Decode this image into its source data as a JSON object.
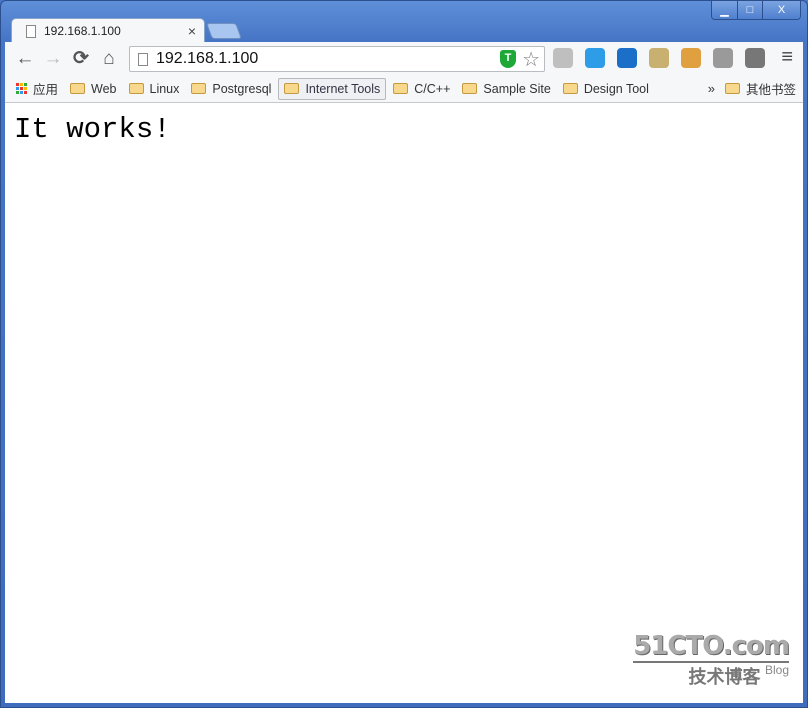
{
  "tab": {
    "title": "192.168.1.100",
    "close": "×"
  },
  "window": {
    "minimize": "▁",
    "maximize": "□",
    "close": "X"
  },
  "toolbar": {
    "back": "←",
    "forward": "→",
    "reload": "⟳",
    "home": "⌂",
    "url": "192.168.1.100",
    "shield": "T",
    "star": "☆",
    "menu": "≡",
    "extensions": [
      {
        "name": "sync-icon",
        "color": "#bfbfbf"
      },
      {
        "name": "pen-icon",
        "color": "#2e9de8"
      },
      {
        "name": "search-ext-icon",
        "color": "#1c6fc9"
      },
      {
        "name": "image-download-icon",
        "color": "#c8b070"
      },
      {
        "name": "color-picker-icon",
        "color": "#e0a040"
      },
      {
        "name": "reader-icon",
        "color": "#9a9a9a"
      },
      {
        "name": "film-icon",
        "color": "#777777"
      }
    ]
  },
  "bookmarks": {
    "apps": "应用",
    "items": [
      "Web",
      "Linux",
      "Postgresql",
      "Internet Tools",
      "C/C++",
      "Sample Site",
      "Design Tool"
    ],
    "active": "Internet Tools",
    "more": "»",
    "other": "其他书签"
  },
  "page": {
    "heading": "It works!"
  },
  "watermark": {
    "site": "51CTO.com",
    "sub": "技术博客",
    "blog": "Blog"
  }
}
